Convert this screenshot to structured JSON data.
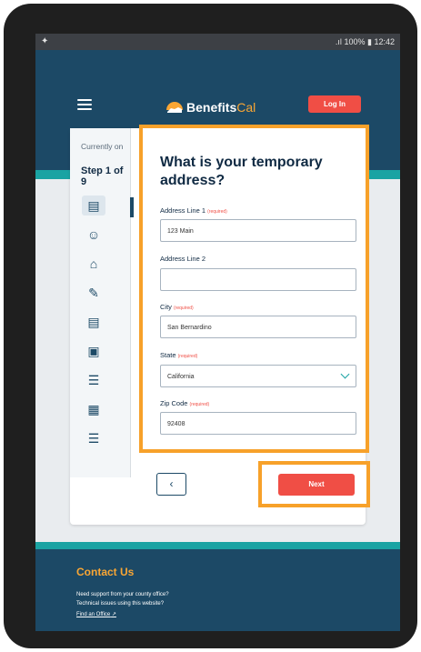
{
  "status_bar": {
    "left_icon": "settings-wrench",
    "signal": ".ıl",
    "battery": "100%",
    "time": "12:42"
  },
  "header": {
    "brand_part1": "Benefits",
    "brand_part2": "Cal",
    "login_label": "Log In"
  },
  "sidebar": {
    "currently_on": "Currently on",
    "step": "Step 1 of 9",
    "icons": [
      "id-card-icon",
      "people-icon",
      "home-person-icon",
      "signature-icon",
      "clipboard-icon",
      "car-icon",
      "list-icon",
      "money-doc-icon",
      "list-icon-2"
    ]
  },
  "form": {
    "title": "What is your temporary address?",
    "required_tag": "(required)",
    "address1": {
      "label": "Address Line 1",
      "value": "123 Main"
    },
    "address2": {
      "label": "Address Line 2",
      "value": ""
    },
    "city": {
      "label": "City",
      "value": "San Bernardino"
    },
    "state": {
      "label": "State",
      "value": "California"
    },
    "zip": {
      "label": "Zip Code",
      "value": "92408"
    }
  },
  "nav": {
    "back_symbol": "‹",
    "next_label": "Next"
  },
  "footer": {
    "title": "Contact Us",
    "line1": "Need support from your county office?",
    "line2": "Technical issues using this website?",
    "link": "Find an Office"
  },
  "colors": {
    "navy": "#1c4966",
    "teal": "#1aa3a3",
    "accent_red": "#f04e45",
    "highlight_orange": "#f7a12a",
    "brand_gold": "#f9a634"
  }
}
